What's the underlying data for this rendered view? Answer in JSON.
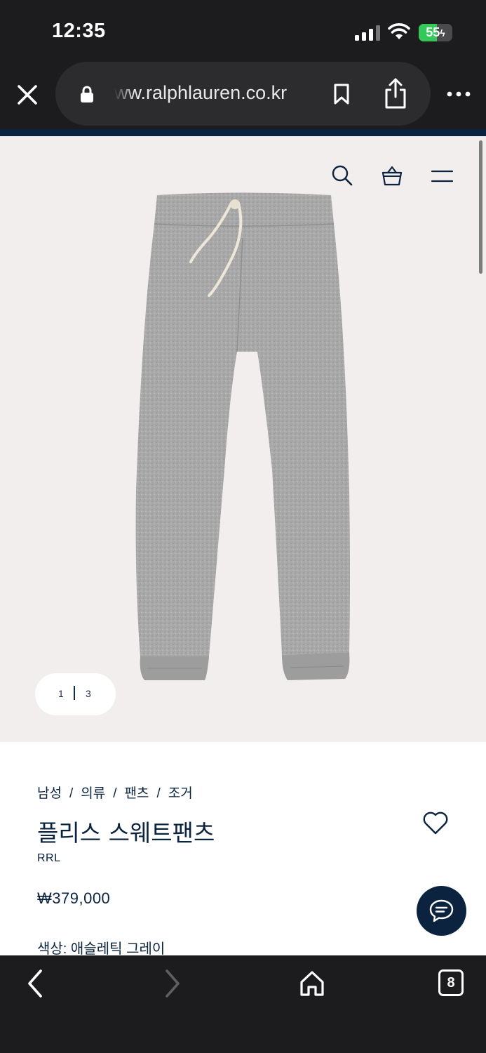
{
  "status_bar": {
    "time": "12:35",
    "battery": "55",
    "battery_level": 0.55
  },
  "browser": {
    "url": "ww.ralphlauren.co.kr",
    "tab_count": "8"
  },
  "gallery": {
    "current": "1",
    "total": "3"
  },
  "product": {
    "breadcrumb": [
      "남성",
      "의류",
      "팬츠",
      "조거"
    ],
    "breadcrumb_sep": "/",
    "title": "플리스 스웨트팬츠",
    "brand": "RRL",
    "price": "₩379,000",
    "color_label": "색상: 애슬레틱 그레이"
  },
  "colors": {
    "navy": "#0c2340",
    "hero_bg": "#f1eeed",
    "chrome": "#1c1c1e",
    "battery_green": "#34c759"
  },
  "icons": [
    "close-icon",
    "lock-icon",
    "bookmark-icon",
    "share-icon",
    "more-icon",
    "search-icon",
    "shopping-bag-icon",
    "menu-icon",
    "heart-icon",
    "chat-icon",
    "back-icon",
    "forward-icon",
    "home-icon",
    "tabs-icon"
  ]
}
